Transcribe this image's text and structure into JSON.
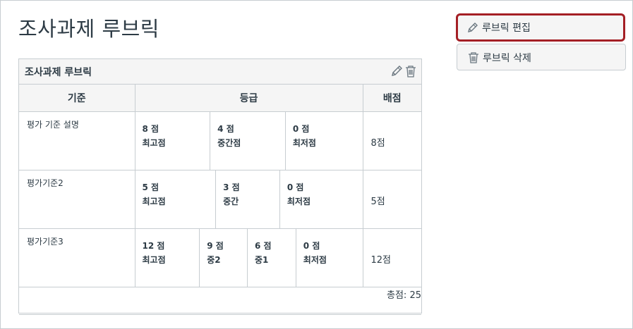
{
  "page": {
    "title": "조사과제 루브릭"
  },
  "actions": {
    "edit_label": "루브릭 편집",
    "delete_label": "루브릭 삭제"
  },
  "rubric": {
    "title": "조사과제 루브릭",
    "columns": {
      "criteria": "기준",
      "ratings": "등급",
      "points": "배점"
    },
    "criteria": [
      {
        "description": "평가 기준 설명",
        "points": "8점",
        "ratings": [
          {
            "points": "8 점",
            "label": "최고점"
          },
          {
            "points": "4 점",
            "label": "중간점"
          },
          {
            "points": "0 점",
            "label": "최저점"
          }
        ]
      },
      {
        "description": "평가기준2",
        "points": "5점",
        "ratings": [
          {
            "points": "5 점",
            "label": "최고점"
          },
          {
            "points": "3 점",
            "label": "중간"
          },
          {
            "points": "0 점",
            "label": "최저점"
          }
        ]
      },
      {
        "description": "평가기준3",
        "points": "12점",
        "ratings": [
          {
            "points": "12 점",
            "label": "최고점"
          },
          {
            "points": "9 점",
            "label": "중2"
          },
          {
            "points": "6 점",
            "label": "중1"
          },
          {
            "points": "0 점",
            "label": "최저점"
          }
        ]
      }
    ],
    "total": "총점: 25"
  },
  "icons": {
    "edit": "pencil-icon",
    "delete": "trash-icon"
  }
}
